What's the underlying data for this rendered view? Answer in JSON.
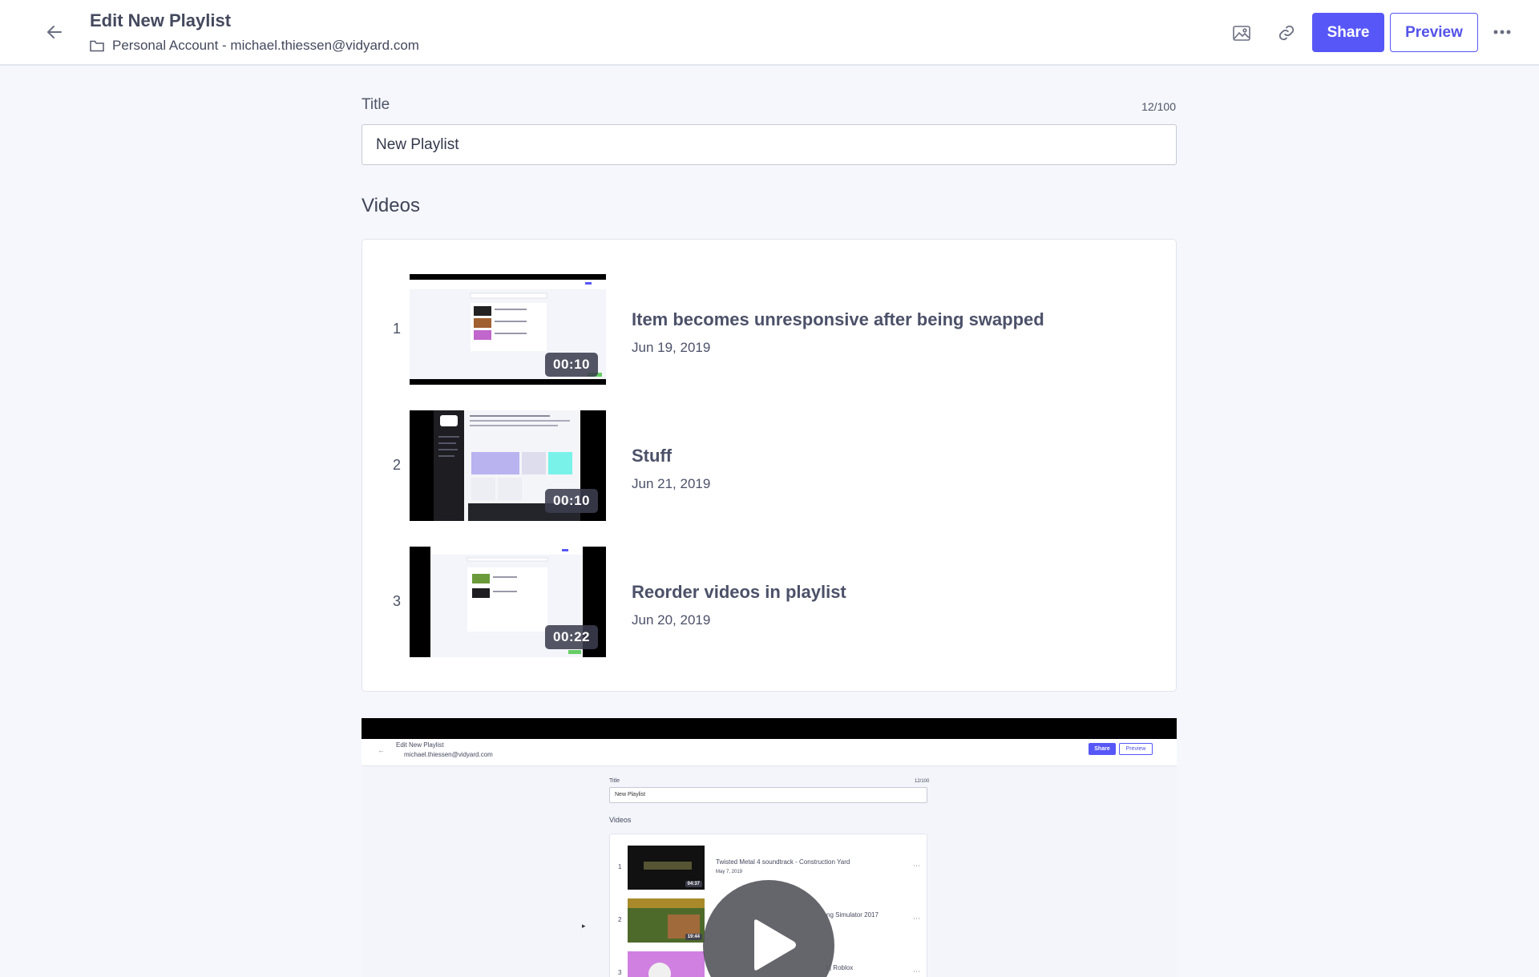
{
  "header": {
    "title": "Edit New Playlist",
    "account": "Personal Account - michael.thiessen@vidyard.com",
    "share_label": "Share",
    "preview_label": "Preview",
    "icons": [
      "back-arrow-icon",
      "folder-icon",
      "image-icon",
      "link-icon",
      "more-icon"
    ]
  },
  "form": {
    "title_label": "Title",
    "title_count": "12/100",
    "title_value": "New Playlist",
    "videos_heading": "Videos"
  },
  "videos": [
    {
      "index": "1",
      "title": "Item becomes unresponsive after being swapped",
      "date": "Jun 19, 2019",
      "duration": "00:10"
    },
    {
      "index": "2",
      "title": "Stuff",
      "date": "Jun 21, 2019",
      "duration": "00:10"
    },
    {
      "index": "3",
      "title": "Reorder videos in playlist",
      "date": "Jun 20, 2019",
      "duration": "00:22"
    }
  ],
  "player_preview": {
    "header_title": "Edit New Playlist",
    "header_account": "michael.thiessen@vidyard.com",
    "share_label": "Share",
    "preview_label": "Preview",
    "title_label": "Title",
    "title_count": "12/100",
    "title_value": "New Playlist",
    "videos_heading": "Videos",
    "videos": [
      {
        "index": "1",
        "title": "Twisted Metal 4 soundtrack - Construction Yard",
        "date": "May 7, 2019",
        "duration": "04:37"
      },
      {
        "index": "2",
        "title": "ng Simulator 2017",
        "duration": "19:44"
      },
      {
        "index": "3",
        "title": "l | Roblox"
      }
    ]
  }
}
